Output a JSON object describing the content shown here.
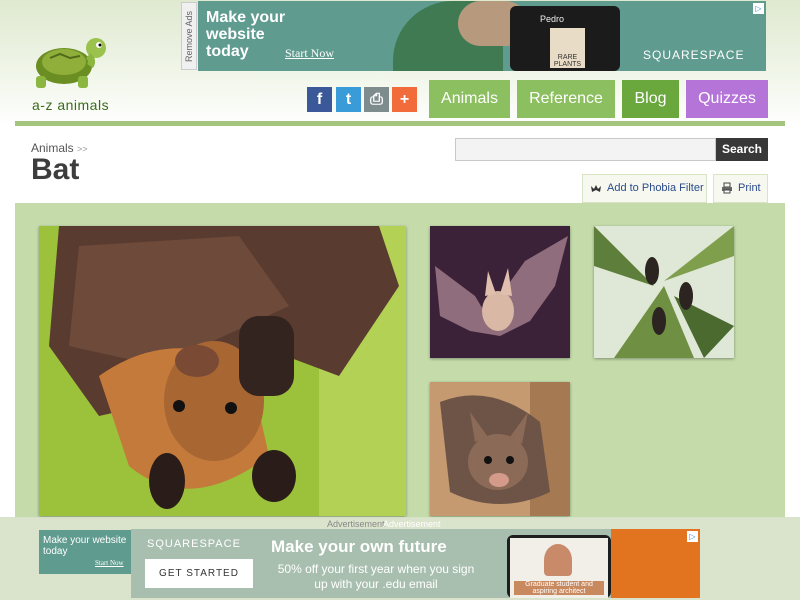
{
  "site": {
    "name": "a-z animals"
  },
  "top_ad": {
    "remove_label": "Remove Ads",
    "headline": "Make your website today",
    "cta": "Start Now",
    "device_name": "Pedro",
    "book_title": "RARE PLANTS",
    "brand": "SQUARESPACE"
  },
  "share": [
    {
      "name": "facebook",
      "glyph": "f",
      "color": "#3b5998"
    },
    {
      "name": "twitter",
      "glyph": "t",
      "color": "#3a9bd9"
    },
    {
      "name": "print",
      "glyph": "⎙",
      "color": "#7f8c8d"
    },
    {
      "name": "more",
      "glyph": "+",
      "color": "#f26b3a"
    }
  ],
  "nav": [
    {
      "label": "Animals",
      "color": "#8cbf5f"
    },
    {
      "label": "Reference",
      "color": "#8cbf5f"
    },
    {
      "label": "Blog",
      "color": "#6aa83d"
    },
    {
      "label": "Quizzes",
      "color": "#b574d8"
    }
  ],
  "breadcrumb": {
    "label": "Animals",
    "separator": ">>"
  },
  "page": {
    "title": "Bat"
  },
  "search": {
    "placeholder": "",
    "button": "Search"
  },
  "actions": {
    "phobia": "Add to Phobia Filter",
    "print": "Print"
  },
  "gallery": [
    {
      "name": "fruit-bat-hanging"
    },
    {
      "name": "bat-in-flight"
    },
    {
      "name": "bats-in-palm-tree"
    },
    {
      "name": "vampire-bat"
    }
  ],
  "ads": {
    "label": "Advertisement",
    "small_headline": "Make your website today",
    "small_cta": "Start Now",
    "bottom": {
      "brand": "SQUARESPACE",
      "cta": "GET STARTED",
      "headline": "Make your own future",
      "sub": "50% off your first year when you sign up with your .edu email",
      "caption": "Graduate student and aspiring architect"
    }
  }
}
